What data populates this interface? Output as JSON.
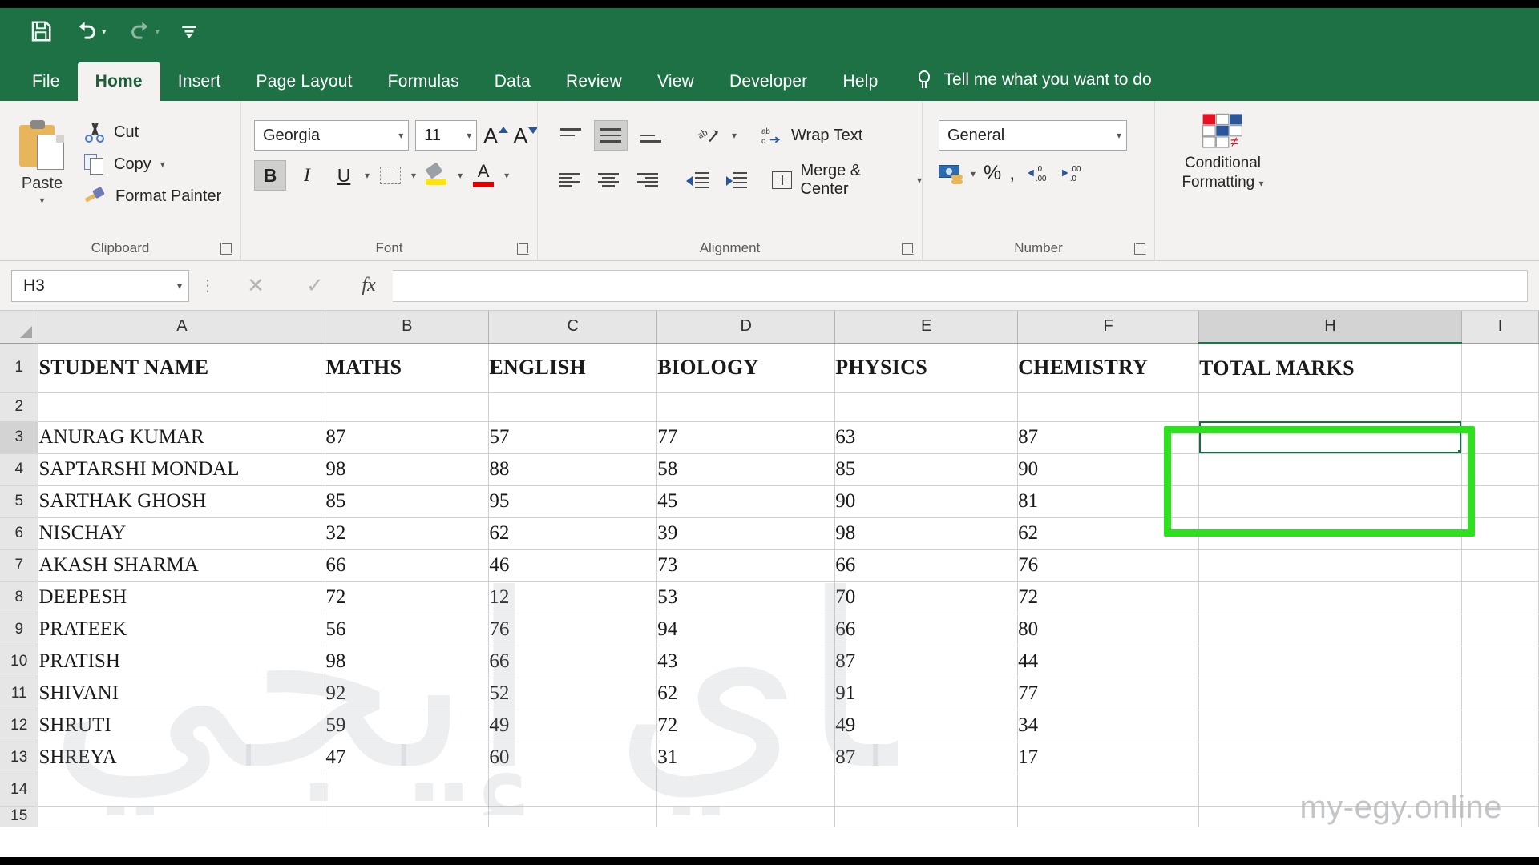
{
  "quick_access": {
    "items": [
      {
        "name": "save-icon",
        "label": "Save"
      },
      {
        "name": "undo-icon",
        "label": "Undo"
      },
      {
        "name": "redo-icon",
        "label": "Redo"
      },
      {
        "name": "customize-quick-access-icon",
        "label": "Customize Quick Access Toolbar"
      }
    ]
  },
  "ribbon": {
    "tabs": [
      {
        "label": "File",
        "active": false
      },
      {
        "label": "Home",
        "active": true
      },
      {
        "label": "Insert",
        "active": false
      },
      {
        "label": "Page Layout",
        "active": false
      },
      {
        "label": "Formulas",
        "active": false
      },
      {
        "label": "Data",
        "active": false
      },
      {
        "label": "Review",
        "active": false
      },
      {
        "label": "View",
        "active": false
      },
      {
        "label": "Developer",
        "active": false
      },
      {
        "label": "Help",
        "active": false
      }
    ],
    "tell_me": "Tell me what you want to do",
    "groups": {
      "clipboard": {
        "label": "Clipboard",
        "paste": "Paste",
        "cut": "Cut",
        "copy": "Copy",
        "format_painter": "Format Painter"
      },
      "font": {
        "label": "Font",
        "font_name": "Georgia",
        "font_size": "11",
        "bold": "B",
        "italic": "I",
        "underline": "U"
      },
      "alignment": {
        "label": "Alignment",
        "wrap_text": "Wrap Text",
        "merge_center": "Merge & Center"
      },
      "number": {
        "label": "Number",
        "format": "General",
        "percent": "%",
        "comma": ","
      },
      "conditional_formatting": {
        "label_line1": "Conditional",
        "label_line2": "Formatting"
      }
    }
  },
  "formula_bar": {
    "name_box": "H3",
    "cancel": "✕",
    "enter": "✓",
    "fx": "fx",
    "value": ""
  },
  "sheet": {
    "columns": [
      "A",
      "B",
      "C",
      "D",
      "E",
      "F",
      "H",
      "I"
    ],
    "selected_column": "H",
    "selected_cell": "H3",
    "row_numbers": [
      "1",
      "2",
      "3",
      "4",
      "5",
      "6",
      "7",
      "8",
      "9",
      "10",
      "11",
      "12",
      "13",
      "14",
      "15"
    ],
    "headers": [
      "STUDENT NAME",
      "MATHS",
      "ENGLISH",
      "BIOLOGY",
      "PHYSICS",
      "CHEMISTRY",
      "TOTAL MARKS",
      ""
    ],
    "rows": [
      {
        "row": "3",
        "cells": [
          "ANURAG KUMAR",
          "87",
          "57",
          "77",
          "63",
          "87",
          "",
          ""
        ]
      },
      {
        "row": "4",
        "cells": [
          "SAPTARSHI MONDAL",
          "98",
          "88",
          "58",
          "85",
          "90",
          "",
          ""
        ]
      },
      {
        "row": "5",
        "cells": [
          "SARTHAK GHOSH",
          "85",
          "95",
          "45",
          "90",
          "81",
          "",
          ""
        ]
      },
      {
        "row": "6",
        "cells": [
          "NISCHAY",
          "32",
          "62",
          "39",
          "98",
          "62",
          "",
          ""
        ]
      },
      {
        "row": "7",
        "cells": [
          "AKASH SHARMA",
          "66",
          "46",
          "73",
          "66",
          "76",
          "",
          ""
        ]
      },
      {
        "row": "8",
        "cells": [
          "DEEPESH",
          "72",
          "12",
          "53",
          "70",
          "72",
          "",
          ""
        ]
      },
      {
        "row": "9",
        "cells": [
          "PRATEEK",
          "56",
          "76",
          "94",
          "66",
          "80",
          "",
          ""
        ]
      },
      {
        "row": "10",
        "cells": [
          "PRATISH",
          "98",
          "66",
          "43",
          "87",
          "44",
          "",
          ""
        ]
      },
      {
        "row": "11",
        "cells": [
          "SHIVANI",
          "92",
          "52",
          "62",
          "91",
          "77",
          "",
          ""
        ]
      },
      {
        "row": "12",
        "cells": [
          "SHRUTI",
          "59",
          "49",
          "72",
          "49",
          "34",
          "",
          ""
        ]
      },
      {
        "row": "13",
        "cells": [
          "SHREYA",
          "47",
          "60",
          "31",
          "87",
          "17",
          "",
          ""
        ]
      }
    ]
  },
  "annotation": {
    "color": "#2ee01f",
    "target_cell": "H3"
  },
  "watermark": {
    "text": "my-egy.online",
    "arabic": "ماي إيجي"
  },
  "colors": {
    "ribbon_green": "#1E7145",
    "excel_accent": "#217346",
    "selection_border": "#1b6b44",
    "annotation_green": "#2ee01f"
  }
}
